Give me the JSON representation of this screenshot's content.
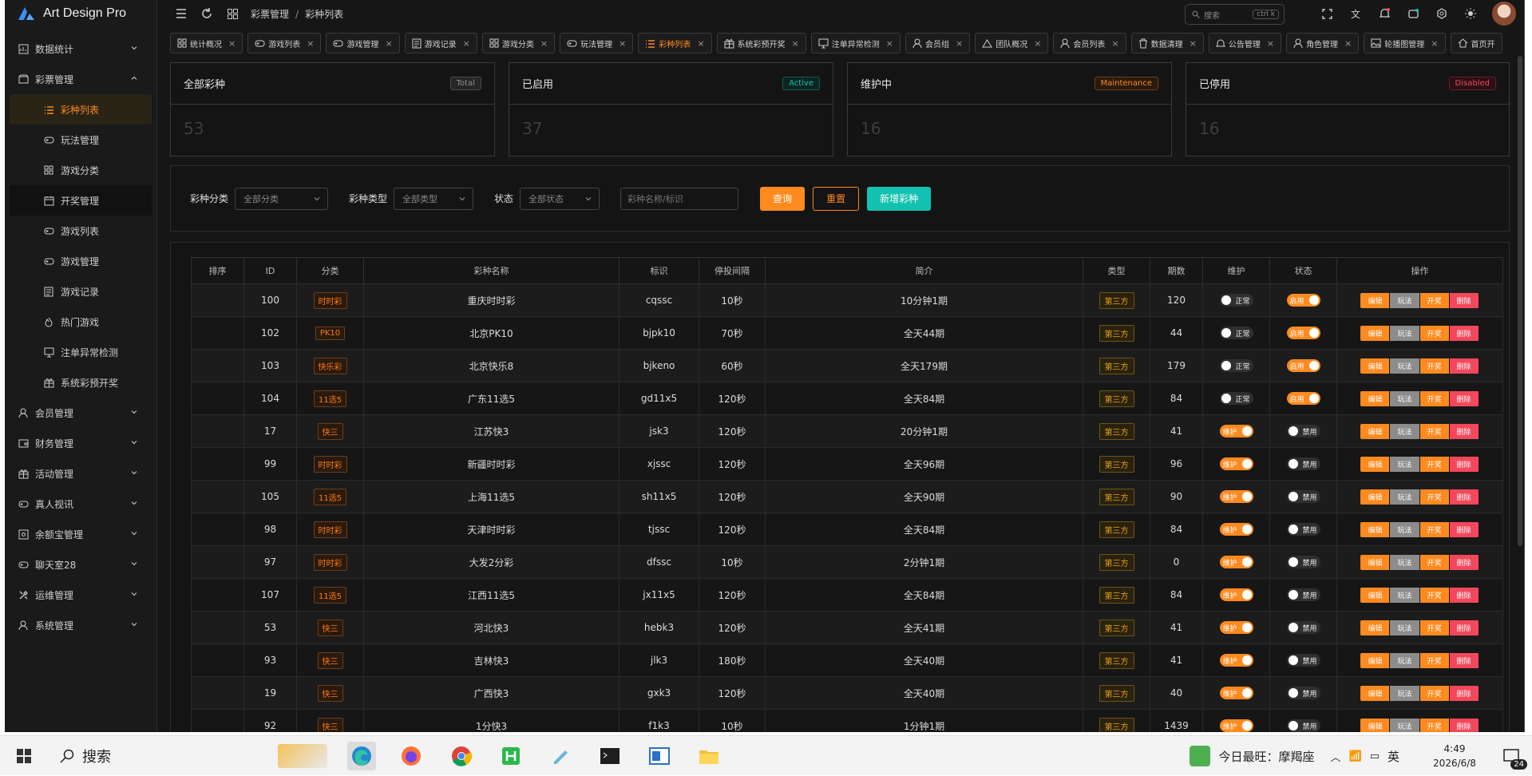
{
  "app": {
    "title": "Art Design Pro"
  },
  "sidebar": {
    "items": [
      {
        "label": "数据统计",
        "icon": "chart-icon",
        "type": "group",
        "expanded": false
      },
      {
        "label": "彩票管理",
        "icon": "ticket-icon",
        "type": "group",
        "expanded": true
      },
      {
        "label": "彩种列表",
        "icon": "list-icon",
        "type": "sub",
        "active": true
      },
      {
        "label": "玩法管理",
        "icon": "gamepad-icon",
        "type": "sub"
      },
      {
        "label": "游戏分类",
        "icon": "grid-icon",
        "type": "sub"
      },
      {
        "label": "开奖管理",
        "icon": "calendar-icon",
        "type": "sub",
        "hover": true
      },
      {
        "label": "游戏列表",
        "icon": "gamepad-icon",
        "type": "sub"
      },
      {
        "label": "游戏管理",
        "icon": "gamepad-icon",
        "type": "sub"
      },
      {
        "label": "游戏记录",
        "icon": "document-icon",
        "type": "sub"
      },
      {
        "label": "热门游戏",
        "icon": "flame-icon",
        "type": "sub"
      },
      {
        "label": "注单异常检测",
        "icon": "monitor-icon",
        "type": "sub"
      },
      {
        "label": "系统彩预开奖",
        "icon": "gift-icon",
        "type": "sub"
      },
      {
        "label": "会员管理",
        "icon": "user-icon",
        "type": "group"
      },
      {
        "label": "财务管理",
        "icon": "wallet-icon",
        "type": "group"
      },
      {
        "label": "活动管理",
        "icon": "gift-icon",
        "type": "group"
      },
      {
        "label": "真人视讯",
        "icon": "gamepad-icon",
        "type": "group"
      },
      {
        "label": "余额宝管理",
        "icon": "safe-icon",
        "type": "group"
      },
      {
        "label": "聊天室28",
        "icon": "gamepad-icon",
        "type": "group"
      },
      {
        "label": "运维管理",
        "icon": "tools-icon",
        "type": "group"
      },
      {
        "label": "系统管理",
        "icon": "user-icon",
        "type": "group"
      }
    ]
  },
  "header": {
    "breadcrumb": [
      "彩票管理",
      "彩种列表"
    ],
    "search_placeholder": "搜索",
    "search_kbd": "ctrl k"
  },
  "tabs": [
    {
      "label": "统计概况",
      "icon": "grid-icon"
    },
    {
      "label": "游戏列表",
      "icon": "gamepad-icon"
    },
    {
      "label": "游戏管理",
      "icon": "gamepad-icon"
    },
    {
      "label": "游戏记录",
      "icon": "document-icon"
    },
    {
      "label": "游戏分类",
      "icon": "grid-icon"
    },
    {
      "label": "玩法管理",
      "icon": "gamepad-icon"
    },
    {
      "label": "彩种列表",
      "icon": "list-icon",
      "active": true
    },
    {
      "label": "系统彩预开奖",
      "icon": "gift-icon"
    },
    {
      "label": "注单异常检测",
      "icon": "monitor-icon"
    },
    {
      "label": "会员组",
      "icon": "user-icon"
    },
    {
      "label": "团队概况",
      "icon": "team-icon"
    },
    {
      "label": "会员列表",
      "icon": "user-icon"
    },
    {
      "label": "数据清理",
      "icon": "trash-icon"
    },
    {
      "label": "公告管理",
      "icon": "bell-icon"
    },
    {
      "label": "角色管理",
      "icon": "user-icon"
    },
    {
      "label": "轮播图管理",
      "icon": "image-icon"
    },
    {
      "label": "首页开",
      "icon": "home-icon"
    }
  ],
  "stats": [
    {
      "title": "全部彩种",
      "badge": "Total",
      "value": "53",
      "color": "#8c8c8c"
    },
    {
      "title": "已启用",
      "badge": "Active",
      "value": "37",
      "color": "#13c2b0"
    },
    {
      "title": "维护中",
      "badge": "Maintenance",
      "value": "16",
      "color": "#ff8a1f"
    },
    {
      "title": "已停用",
      "badge": "Disabled",
      "value": "16",
      "color": "#f5475b"
    }
  ],
  "filter": {
    "category_label": "彩种分类",
    "category_value": "全部分类",
    "type_label": "彩种类型",
    "type_value": "全部类型",
    "status_label": "状态",
    "status_value": "全部状态",
    "keyword_placeholder": "彩种名称/标识",
    "query_btn": "查询",
    "reset_btn": "重置",
    "add_btn": "新增彩种"
  },
  "table": {
    "columns": [
      "排序",
      "ID",
      "分类",
      "彩种名称",
      "标识",
      "停投间隔",
      "简介",
      "类型",
      "期数",
      "维护",
      "状态",
      "操作"
    ],
    "actions": [
      "编辑",
      "玩法",
      "开奖",
      "删除"
    ],
    "rows": [
      {
        "sort": "",
        "id": "100",
        "cat": "时时彩",
        "name": "重庆时时彩",
        "code": "cqssc",
        "interval": "10秒",
        "desc": "10分钟1期",
        "type": "第三方",
        "issues": "120",
        "maint": "正常",
        "status": "启用"
      },
      {
        "sort": "",
        "id": "102",
        "cat": "PK10",
        "name": "北京PK10",
        "code": "bjpk10",
        "interval": "70秒",
        "desc": "全天44期",
        "type": "第三方",
        "issues": "44",
        "maint": "正常",
        "status": "启用"
      },
      {
        "sort": "",
        "id": "103",
        "cat": "快乐彩",
        "name": "北京快乐8",
        "code": "bjkeno",
        "interval": "60秒",
        "desc": "全天179期",
        "type": "第三方",
        "issues": "179",
        "maint": "正常",
        "status": "启用"
      },
      {
        "sort": "",
        "id": "104",
        "cat": "11选5",
        "name": "广东11选5",
        "code": "gd11x5",
        "interval": "120秒",
        "desc": "全天84期",
        "type": "第三方",
        "issues": "84",
        "maint": "正常",
        "status": "启用"
      },
      {
        "sort": "",
        "id": "17",
        "cat": "快三",
        "name": "江苏快3",
        "code": "jsk3",
        "interval": "120秒",
        "desc": "20分钟1期",
        "type": "第三方",
        "issues": "41",
        "maint": "维护",
        "status": "禁用"
      },
      {
        "sort": "",
        "id": "99",
        "cat": "时时彩",
        "name": "新疆时时彩",
        "code": "xjssc",
        "interval": "120秒",
        "desc": "全天96期",
        "type": "第三方",
        "issues": "96",
        "maint": "维护",
        "status": "禁用"
      },
      {
        "sort": "",
        "id": "105",
        "cat": "11选5",
        "name": "上海11选5",
        "code": "sh11x5",
        "interval": "120秒",
        "desc": "全天90期",
        "type": "第三方",
        "issues": "90",
        "maint": "维护",
        "status": "禁用"
      },
      {
        "sort": "",
        "id": "98",
        "cat": "时时彩",
        "name": "天津时时彩",
        "code": "tjssc",
        "interval": "120秒",
        "desc": "全天84期",
        "type": "第三方",
        "issues": "84",
        "maint": "维护",
        "status": "禁用"
      },
      {
        "sort": "",
        "id": "97",
        "cat": "时时彩",
        "name": "大发2分彩",
        "code": "dfssc",
        "interval": "10秒",
        "desc": "2分钟1期",
        "type": "第三方",
        "issues": "0",
        "maint": "维护",
        "status": "禁用"
      },
      {
        "sort": "",
        "id": "107",
        "cat": "11选5",
        "name": "江西11选5",
        "code": "jx11x5",
        "interval": "120秒",
        "desc": "全天84期",
        "type": "第三方",
        "issues": "84",
        "maint": "维护",
        "status": "禁用"
      },
      {
        "sort": "",
        "id": "53",
        "cat": "快三",
        "name": "河北快3",
        "code": "hebk3",
        "interval": "120秒",
        "desc": "全天41期",
        "type": "第三方",
        "issues": "41",
        "maint": "维护",
        "status": "禁用"
      },
      {
        "sort": "",
        "id": "93",
        "cat": "快三",
        "name": "吉林快3",
        "code": "jlk3",
        "interval": "180秒",
        "desc": "全天40期",
        "type": "第三方",
        "issues": "41",
        "maint": "维护",
        "status": "禁用"
      },
      {
        "sort": "",
        "id": "19",
        "cat": "快三",
        "name": "广西快3",
        "code": "gxk3",
        "interval": "120秒",
        "desc": "全天40期",
        "type": "第三方",
        "issues": "40",
        "maint": "维护",
        "status": "禁用"
      },
      {
        "sort": "",
        "id": "92",
        "cat": "快三",
        "name": "1分快3",
        "code": "f1k3",
        "interval": "10秒",
        "desc": "1分钟1期",
        "type": "第三方",
        "issues": "1439",
        "maint": "维护",
        "status": "禁用"
      }
    ]
  },
  "taskbar": {
    "search": "搜索",
    "weather": "今日最旺：摩羯座",
    "ime": "英",
    "time": "4:49",
    "date": "2026/6/8",
    "notif_count": "24"
  }
}
